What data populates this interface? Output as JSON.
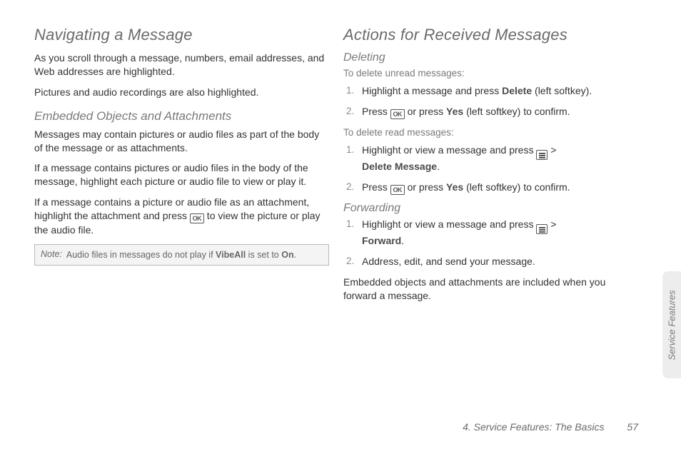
{
  "left": {
    "h1": "Navigating a Message",
    "p1": "As you scroll through a message, numbers, email addresses, and Web addresses are highlighted.",
    "p2": "Pictures and audio recordings are also highlighted.",
    "h2": "Embedded Objects and Attachments",
    "p3": "Messages may contain pictures or audio files as part of the body of the message or as attachments.",
    "p4": "If a message contains pictures or audio files in the body of the message, highlight each picture or audio file to view or play it.",
    "p5a": "If a message contains a picture or audio file as an attachment, highlight the attachment and press ",
    "p5b": " to view the picture or play the audio file.",
    "note_label": "Note:",
    "note_a": "Audio files in messages do not play if ",
    "note_b": "VibeAll",
    "note_c": " is set to ",
    "note_d": "On",
    "note_e": "."
  },
  "right": {
    "h1": "Actions for Received Messages",
    "h2a": "Deleting",
    "lead1": "To delete unread messages:",
    "s1_1a": "Highlight a message and press ",
    "s1_1b": "Delete",
    "s1_1c": " (left softkey).",
    "s1_2a": "Press ",
    "s1_2b": " or press ",
    "s1_2c": "Yes",
    "s1_2d": " (left softkey) to confirm.",
    "lead2": "To delete read messages:",
    "s2_1a": "Highlight or view a message and press ",
    "s2_1b": " > ",
    "s2_1c": "Delete Message",
    "s2_1d": ".",
    "s2_2a": "Press ",
    "s2_2b": " or press ",
    "s2_2c": "Yes",
    "s2_2d": " (left softkey) to confirm.",
    "h2b": "Forwarding",
    "s3_1a": "Highlight or view a message and press ",
    "s3_1b": " > ",
    "s3_1c": "Forward",
    "s3_1d": ".",
    "s3_2": "Address, edit, and send your message.",
    "p_end": "Embedded objects and attachments are included when you forward a message."
  },
  "footer": {
    "chapter": "4. Service Features: The Basics",
    "page": "57"
  },
  "sidetab": "Service Features",
  "icons": {
    "ok": "OK"
  }
}
